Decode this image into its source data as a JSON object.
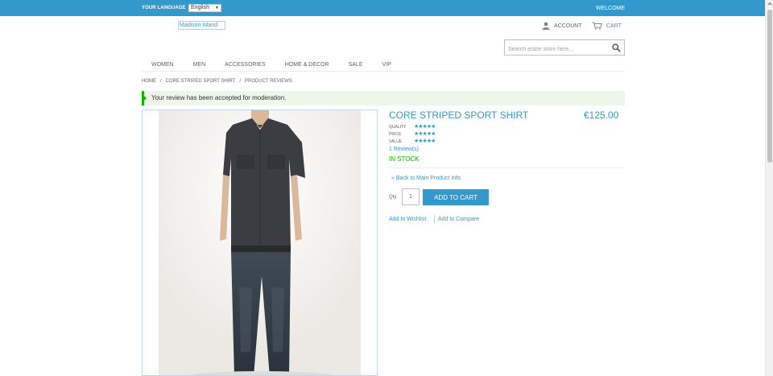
{
  "topbar": {
    "language_label": "Your Language",
    "language_value": "English",
    "welcome": "Welcome"
  },
  "header": {
    "logo_alt": "Madison Island",
    "account_label": "Account",
    "cart_label": "Cart",
    "search_placeholder": "Search entire store here..."
  },
  "nav": {
    "items": [
      {
        "label": "Women"
      },
      {
        "label": "Men"
      },
      {
        "label": "Accessories"
      },
      {
        "label": "Home & Decor"
      },
      {
        "label": "Sale"
      },
      {
        "label": "VIP"
      }
    ]
  },
  "breadcrumb": {
    "home": "Home",
    "product": "Core Striped Sport Shirt",
    "current": "Product Reviews"
  },
  "message": {
    "text": "Your review has been accepted for moderation."
  },
  "product": {
    "name": "Core Striped Sport Shirt",
    "price": "€125.00",
    "ratings": [
      {
        "label": "Quality",
        "stars": "★★★★★"
      },
      {
        "label": "Price",
        "stars": "★★★★★"
      },
      {
        "label": "Value",
        "stars": "★★★★★"
      }
    ],
    "reviews_link": "1 Review(s)",
    "stock": "In stock",
    "back_link": "« Back to Main Product Info",
    "qty_label": "Qty",
    "qty_value": "1",
    "add_to_cart": "Add to Cart",
    "wishlist": "Add to Wishlist",
    "compare": "Add to Compare"
  },
  "colors": {
    "accent": "#3399cc",
    "success": "#11b400",
    "text": "#636363"
  }
}
